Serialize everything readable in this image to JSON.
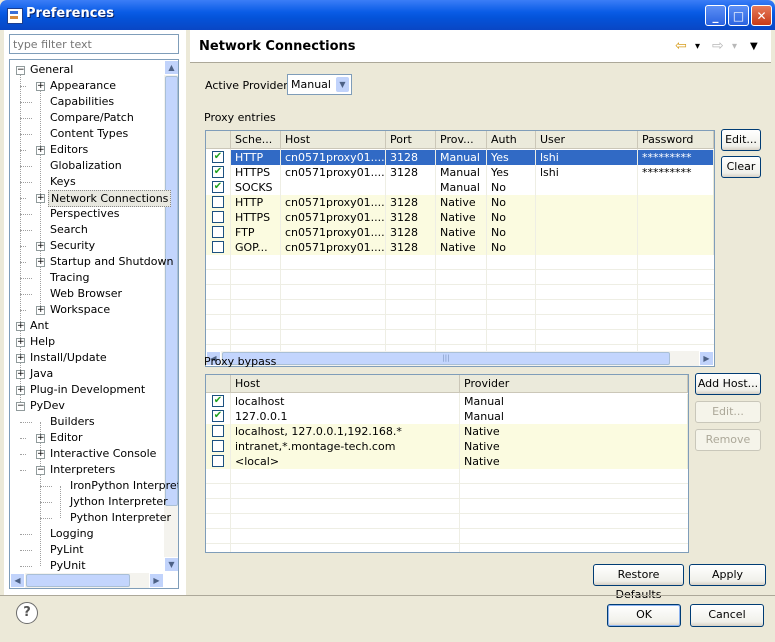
{
  "window": {
    "title": "Preferences",
    "minimize": "_",
    "maximize": "□",
    "close": "✕"
  },
  "sidebar": {
    "filter_placeholder": "type filter text",
    "tree": [
      {
        "label": "General",
        "level": 0,
        "toggle": "−"
      },
      {
        "label": "Appearance",
        "level": 1,
        "toggle": "+"
      },
      {
        "label": "Capabilities",
        "level": 1,
        "toggle": ""
      },
      {
        "label": "Compare/Patch",
        "level": 1,
        "toggle": ""
      },
      {
        "label": "Content Types",
        "level": 1,
        "toggle": ""
      },
      {
        "label": "Editors",
        "level": 1,
        "toggle": "+"
      },
      {
        "label": "Globalization",
        "level": 1,
        "toggle": ""
      },
      {
        "label": "Keys",
        "level": 1,
        "toggle": ""
      },
      {
        "label": "Network Connections",
        "level": 1,
        "toggle": "+",
        "selected": true
      },
      {
        "label": "Perspectives",
        "level": 1,
        "toggle": ""
      },
      {
        "label": "Search",
        "level": 1,
        "toggle": ""
      },
      {
        "label": "Security",
        "level": 1,
        "toggle": "+"
      },
      {
        "label": "Startup and Shutdown",
        "level": 1,
        "toggle": "+"
      },
      {
        "label": "Tracing",
        "level": 1,
        "toggle": ""
      },
      {
        "label": "Web Browser",
        "level": 1,
        "toggle": ""
      },
      {
        "label": "Workspace",
        "level": 1,
        "toggle": "+"
      },
      {
        "label": "Ant",
        "level": 0,
        "toggle": "+"
      },
      {
        "label": "Help",
        "level": 0,
        "toggle": "+"
      },
      {
        "label": "Install/Update",
        "level": 0,
        "toggle": "+"
      },
      {
        "label": "Java",
        "level": 0,
        "toggle": "+"
      },
      {
        "label": "Plug-in Development",
        "level": 0,
        "toggle": "+"
      },
      {
        "label": "PyDev",
        "level": 0,
        "toggle": "−"
      },
      {
        "label": "Builders",
        "level": 1,
        "toggle": ""
      },
      {
        "label": "Editor",
        "level": 1,
        "toggle": "+"
      },
      {
        "label": "Interactive Console",
        "level": 1,
        "toggle": "+"
      },
      {
        "label": "Interpreters",
        "level": 1,
        "toggle": "−"
      },
      {
        "label": "IronPython Interpreter",
        "level": 2,
        "toggle": ""
      },
      {
        "label": "Jython Interpreter",
        "level": 2,
        "toggle": ""
      },
      {
        "label": "Python Interpreter",
        "level": 2,
        "toggle": ""
      },
      {
        "label": "Logging",
        "level": 1,
        "toggle": ""
      },
      {
        "label": "PyLint",
        "level": 1,
        "toggle": ""
      },
      {
        "label": "PyUnit",
        "level": 1,
        "toggle": ""
      }
    ]
  },
  "main": {
    "title": "Network Connections",
    "nav": {
      "back": "⇦",
      "back_menu": "▾",
      "forward": "⇨",
      "forward_menu": "▾",
      "view_menu": "▼"
    },
    "active_provider_label": "Active Provider:",
    "active_provider_value": "Manual",
    "dropdown_arrow": "▼",
    "proxy_entries_label": "Proxy entries",
    "proxy_columns": [
      "",
      "Sche...",
      "Host",
      "Port",
      "Prov...",
      "Auth",
      "User",
      "Password"
    ],
    "proxy_rows": [
      {
        "checked": true,
        "scheme": "HTTP",
        "host": "cn0571proxy01....",
        "port": "3128",
        "provider": "Manual",
        "auth": "Yes",
        "user": "lshi",
        "password": "*********",
        "selected": true
      },
      {
        "checked": true,
        "scheme": "HTTPS",
        "host": "cn0571proxy01....",
        "port": "3128",
        "provider": "Manual",
        "auth": "Yes",
        "user": "lshi",
        "password": "*********"
      },
      {
        "checked": true,
        "scheme": "SOCKS",
        "host": "",
        "port": "",
        "provider": "Manual",
        "auth": "No",
        "user": "",
        "password": ""
      },
      {
        "checked": false,
        "scheme": "HTTP",
        "host": "cn0571proxy01....",
        "port": "3128",
        "provider": "Native",
        "auth": "No",
        "user": "",
        "password": ""
      },
      {
        "checked": false,
        "scheme": "HTTPS",
        "host": "cn0571proxy01....",
        "port": "3128",
        "provider": "Native",
        "auth": "No",
        "user": "",
        "password": ""
      },
      {
        "checked": false,
        "scheme": "FTP",
        "host": "cn0571proxy01....",
        "port": "3128",
        "provider": "Native",
        "auth": "No",
        "user": "",
        "password": ""
      },
      {
        "checked": false,
        "scheme": "GOP...",
        "host": "cn0571proxy01....",
        "port": "3128",
        "provider": "Native",
        "auth": "No",
        "user": "",
        "password": ""
      }
    ],
    "edit_button": "Edit...",
    "clear_button": "Clear",
    "proxy_bypass_label": "Proxy bypass",
    "bypass_columns": [
      "",
      "Host",
      "Provider"
    ],
    "bypass_rows": [
      {
        "checked": true,
        "host": "localhost",
        "provider": "Manual"
      },
      {
        "checked": true,
        "host": "127.0.0.1",
        "provider": "Manual"
      },
      {
        "checked": false,
        "host": "localhost, 127.0.0.1,192.168.*",
        "provider": "Native"
      },
      {
        "checked": false,
        "host": "intranet,*.montage-tech.com",
        "provider": "Native"
      },
      {
        "checked": false,
        "host": "<local>",
        "provider": "Native"
      }
    ],
    "add_host_button": "Add Host...",
    "bypass_edit_button": "Edit...",
    "remove_button": "Remove",
    "restore_defaults_button": "Restore Defaults",
    "apply_button": "Apply"
  },
  "footer": {
    "help": "?",
    "ok_button": "OK",
    "cancel_button": "Cancel"
  },
  "scroll": {
    "left": "◀",
    "right": "▶",
    "up": "▲",
    "down": "▼",
    "grip": "|||"
  },
  "check_mark": "✔",
  "colors": {
    "titlebar": "#0a5ce6",
    "selection": "#316ac5",
    "native_row": "#fbfbe0"
  }
}
